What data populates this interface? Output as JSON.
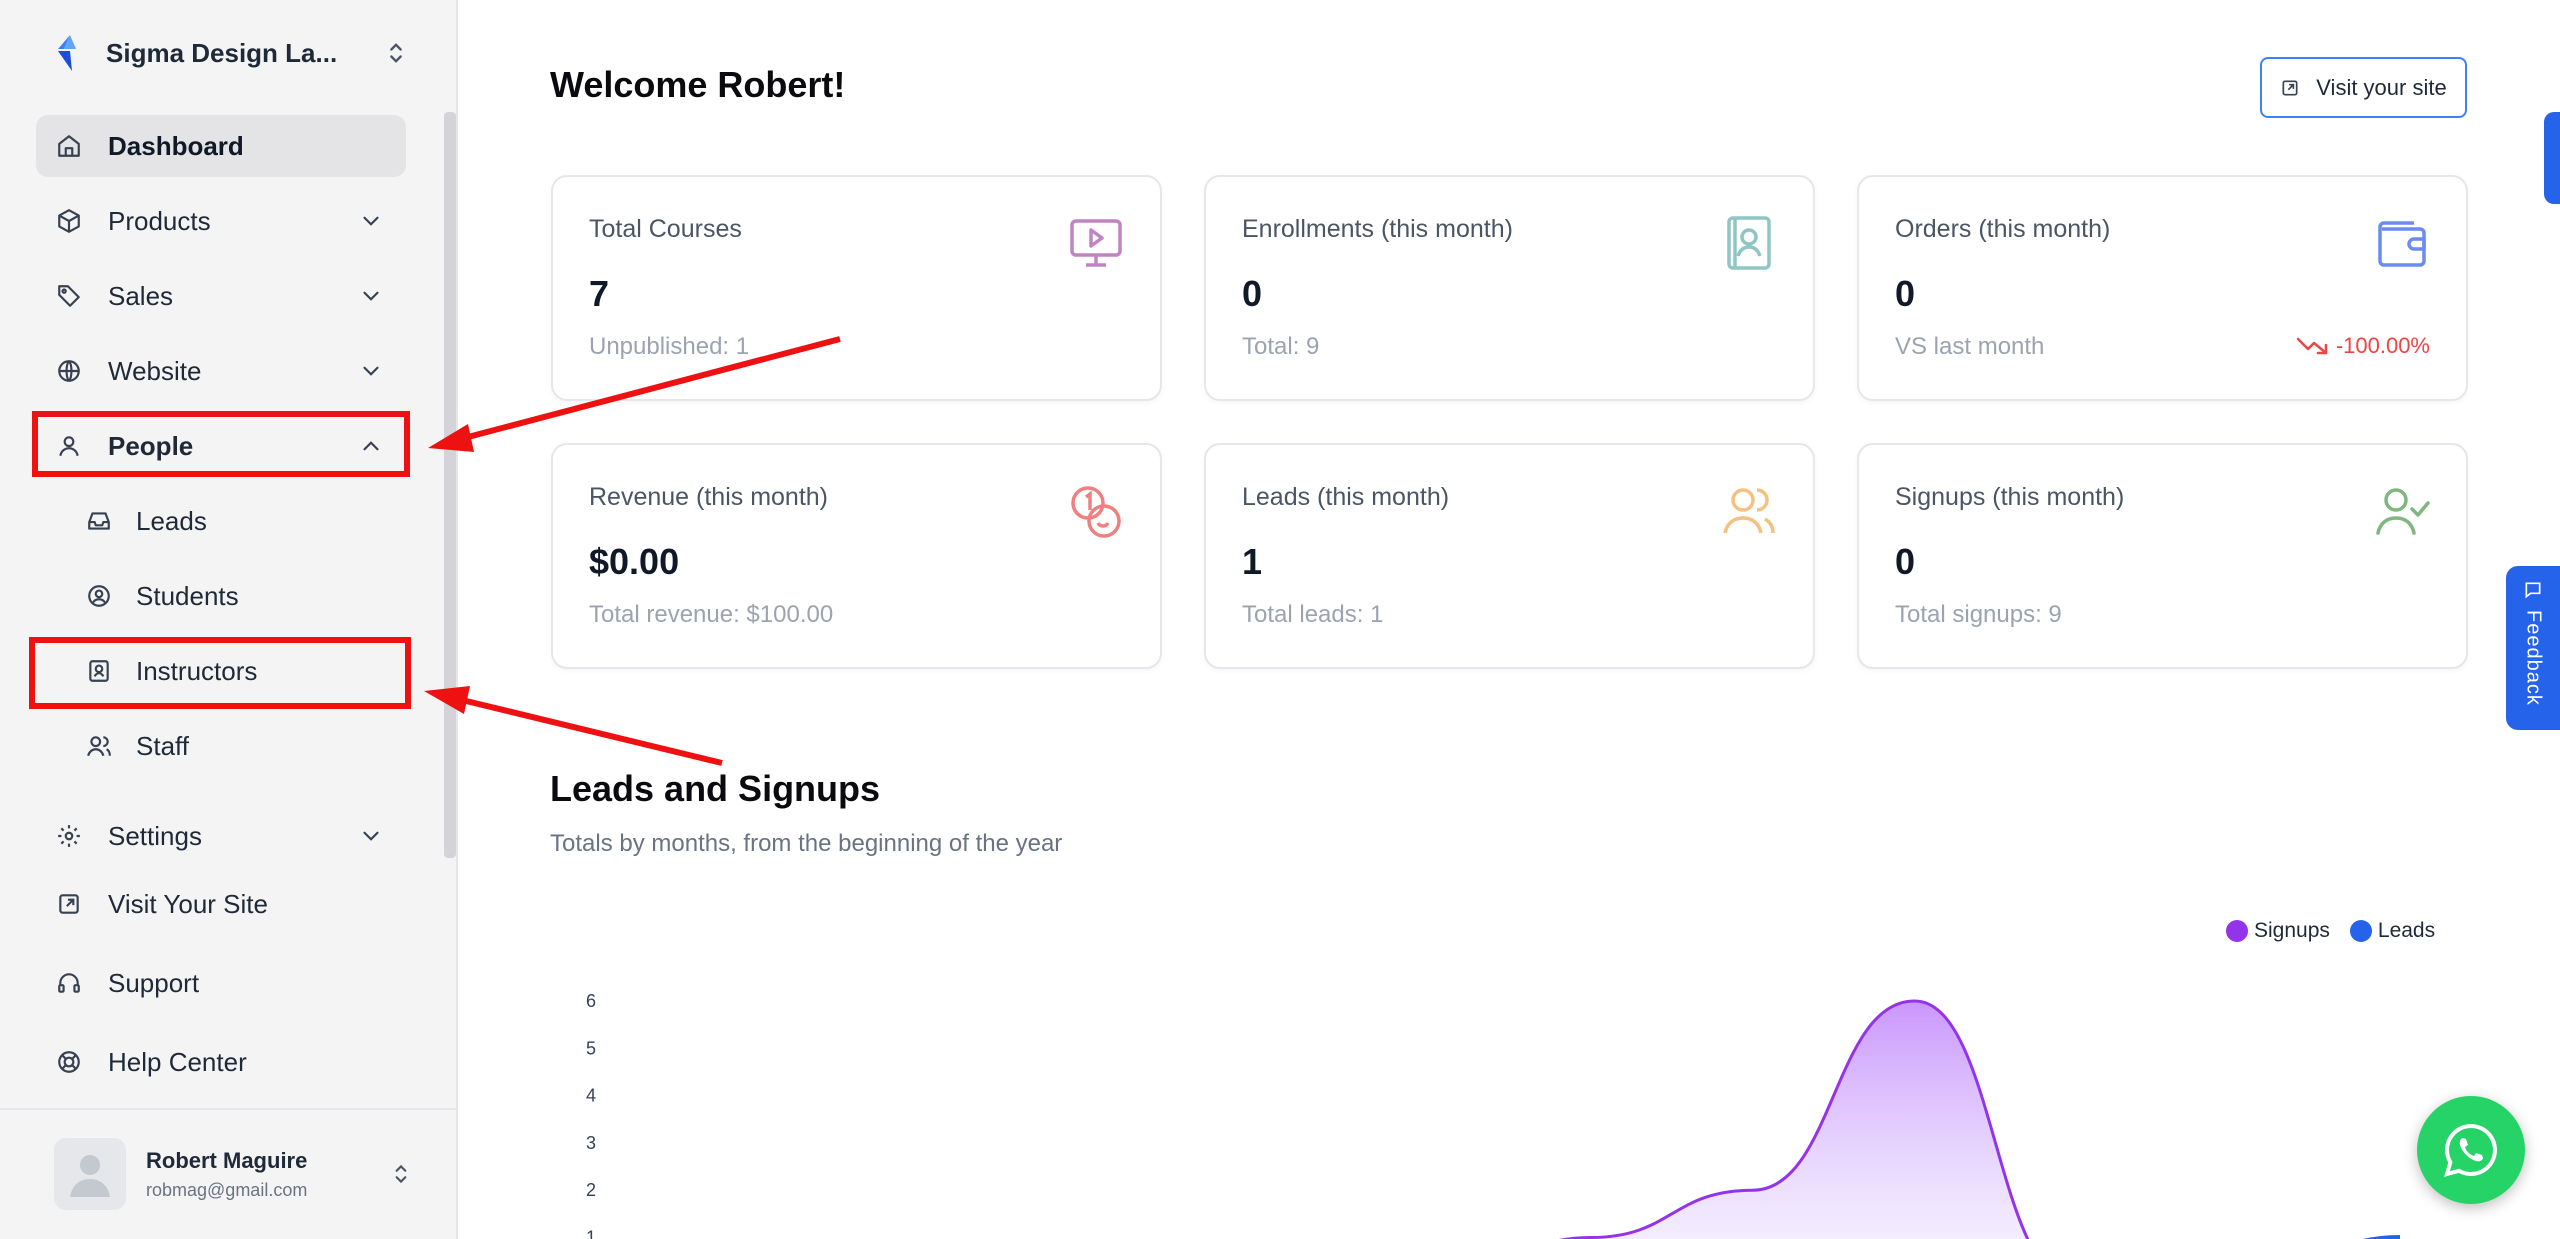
{
  "sidebar": {
    "brand": "Sigma Design La...",
    "nav": {
      "dashboard": "Dashboard",
      "products": "Products",
      "sales": "Sales",
      "website": "Website",
      "people": "People",
      "leads": "Leads",
      "students": "Students",
      "instructors": "Instructors",
      "staff": "Staff",
      "settings": "Settings",
      "visit_site": "Visit Your Site",
      "support": "Support",
      "help_center": "Help Center"
    },
    "user": {
      "name": "Robert Maguire",
      "email": "robmag@gmail.com"
    }
  },
  "header": {
    "welcome": "Welcome Robert!",
    "visit_button": "Visit your site"
  },
  "cards": [
    {
      "title": "Total Courses",
      "value": "7",
      "sub": "Unpublished: 1",
      "icon": "monitor-play-icon"
    },
    {
      "title": "Enrollments (this month)",
      "value": "0",
      "sub": "Total: 9",
      "icon": "contact-book-icon"
    },
    {
      "title": "Orders (this month)",
      "value": "0",
      "sub": "VS last month",
      "trend": "-100.00%",
      "icon": "wallet-icon"
    },
    {
      "title": "Revenue (this month)",
      "value": "$0.00",
      "sub": "Total revenue: $100.00",
      "icon": "coins-icon"
    },
    {
      "title": "Leads (this month)",
      "value": "1",
      "sub": "Total leads: 1",
      "icon": "users-icon"
    },
    {
      "title": "Signups (this month)",
      "value": "0",
      "sub": "Total signups: 9",
      "icon": "user-check-icon"
    }
  ],
  "section": {
    "title": "Leads and Signups",
    "subtitle": "Totals by months, from the beginning of the year"
  },
  "chart_data": {
    "type": "area",
    "series": [
      {
        "name": "Signups",
        "color": "#9333ea",
        "x": [
          1,
          2,
          3,
          4,
          5,
          6,
          7,
          8,
          9,
          10,
          11,
          12
        ],
        "values": [
          0,
          0,
          0,
          0,
          0,
          0,
          1,
          2,
          6,
          0,
          0,
          0
        ]
      },
      {
        "name": "Leads",
        "color": "#2563eb",
        "x": [
          1,
          2,
          3,
          4,
          5,
          6,
          7,
          8,
          9,
          10,
          11,
          12
        ],
        "values": [
          0,
          0,
          0,
          0,
          0,
          0,
          0,
          0,
          0,
          0,
          0,
          1
        ]
      }
    ],
    "yticks": [
      "6",
      "5",
      "4",
      "3",
      "2",
      "1"
    ],
    "ylim": [
      0,
      6
    ],
    "legend": "top-right",
    "grid": false
  },
  "widgets": {
    "feedback": "Feedback"
  },
  "colors": {
    "accent": "#2563eb",
    "signups": "#9333ea",
    "leads": "#2563eb",
    "negative": "#ef4444",
    "whatsapp": "#25d366"
  }
}
